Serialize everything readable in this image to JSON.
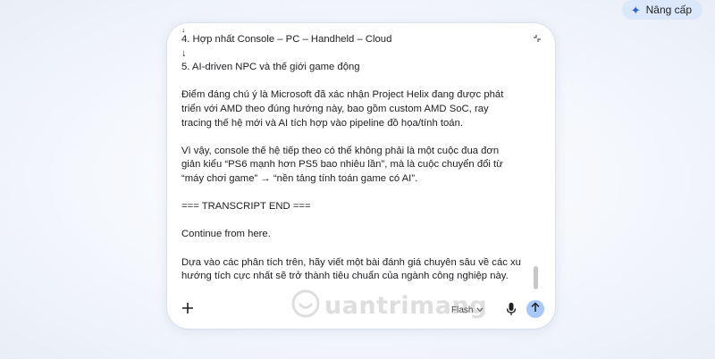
{
  "header": {
    "upgrade_label": "Nâng cấp"
  },
  "message": {
    "lines": [
      "4. Hợp nhất Console – PC – Handheld – Cloud",
      "↓",
      "5. AI-driven NPC và thế giới game động",
      "",
      "Điểm đáng chú ý là Microsoft đã xác nhận Project Helix đang được phát",
      "triển với AMD theo đúng hướng này, bao gồm custom AMD SoC, ray",
      "tracing thế hệ mới và AI tích hợp vào pipeline đồ họa/tính toán.",
      "",
      "Vì vậy, console thế hệ tiếp theo có thể không phải là một cuộc đua đơn",
      "giản kiểu “PS6 mạnh hơn PS5 bao nhiêu lần”, mà là cuộc chuyển đổi từ",
      "“máy chơi game” → “nền tảng tính toán game có AI”.",
      "",
      "=== TRANSCRIPT END ===",
      "",
      "Continue from here.",
      "",
      "Dựa vào các phân tích trên, hãy viết một bài đánh giá chuyên sâu về các xu",
      "hướng tích cực nhất sẽ trở thành tiêu chuẩn của ngành công nghiệp này."
    ]
  },
  "toolbar": {
    "add_icon": "plus-icon",
    "model_label": "Flash",
    "mic_icon": "mic-icon",
    "send_icon": "send-arrow-icon"
  },
  "watermark": {
    "text": "uantrimang"
  },
  "colors": {
    "upgrade_bg": "#dbe7fb",
    "send_bg": "#a8c7fa",
    "accent": "#2b5fd9"
  }
}
